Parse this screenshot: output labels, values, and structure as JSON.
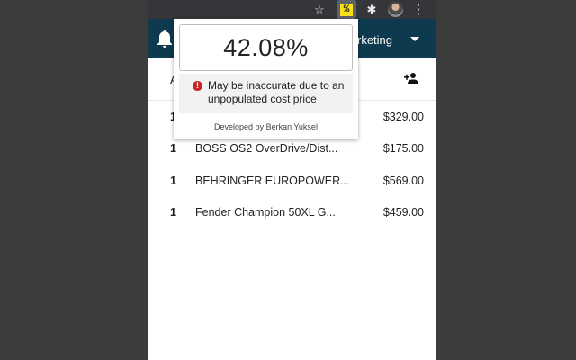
{
  "browser_toolbar": {
    "icons": [
      "star-icon",
      "percent-extension-icon",
      "puzzle-extensions-icon",
      "profile-avatar",
      "kebab-menu-icon"
    ],
    "extension_label": "%",
    "star_glyph": "☆",
    "puzzle_glyph": "✱",
    "kebab_glyph": "⋮"
  },
  "app_header": {
    "visible_text": "rketing",
    "background": "#0e3a50"
  },
  "subbar": {
    "partial_letter": "A"
  },
  "orders": [
    {
      "qty": "1",
      "name": "",
      "price": "$329.00"
    },
    {
      "qty": "1",
      "name": "BOSS OS2 OverDrive/Dist...",
      "price": "$175.00"
    },
    {
      "qty": "1",
      "name": "BEHRINGER EUROPOWER...",
      "price": "$569.00"
    },
    {
      "qty": "1",
      "name": "Fender Champion 50XL G...",
      "price": "$459.00"
    }
  ],
  "popup": {
    "percentage": "42.08%",
    "warning_icon": "!",
    "warning_text": "May be inaccurate due to an unpopulated cost price",
    "developer_text": "Developed by Berkan Yuksel",
    "warning_color": "#c62828"
  }
}
